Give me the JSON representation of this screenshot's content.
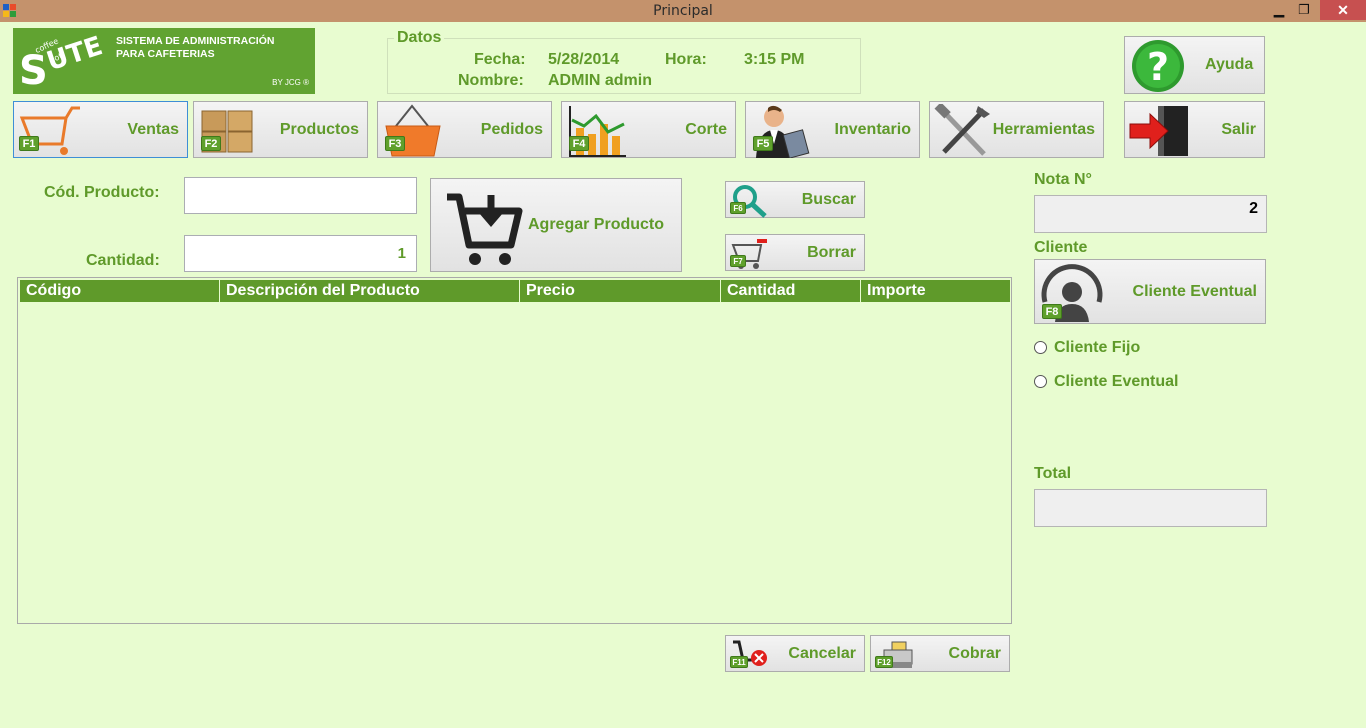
{
  "window": {
    "title": "Principal",
    "controls": {
      "minimize": "▁",
      "maximize": "❐",
      "close": "✕"
    }
  },
  "logo": {
    "brand": "SUITE",
    "tagline_1": "SISTEMA DE ADMINISTRACIÓN",
    "tagline_2": "PARA CAFETERIAS",
    "by": "BY JCG ®"
  },
  "datos": {
    "legend": "Datos",
    "fecha_label": "Fecha:",
    "fecha": "5/28/2014",
    "hora_label": "Hora:",
    "hora": "3:15 PM",
    "nombre_label": "Nombre:",
    "nombre": "ADMIN admin"
  },
  "ayuda": {
    "label": "Ayuda",
    "icon": "question-icon"
  },
  "toolbar": [
    {
      "label": "Ventas",
      "key": "F1",
      "icon": "cart-icon"
    },
    {
      "label": "Productos",
      "key": "F2",
      "icon": "boxes-icon"
    },
    {
      "label": "Pedidos",
      "key": "F3",
      "icon": "basket-icon"
    },
    {
      "label": "Corte",
      "key": "F4",
      "icon": "chart-icon"
    },
    {
      "label": "Inventario",
      "key": "F5",
      "icon": "person-calculator-icon"
    },
    {
      "label": "Herramientas",
      "key": "",
      "icon": "tools-icon"
    },
    {
      "label": "Salir",
      "key": "",
      "icon": "exit-door-icon"
    }
  ],
  "form": {
    "codigo_label": "Cód. Producto:",
    "codigo_value": "",
    "cantidad_label": "Cantidad:",
    "cantidad_value": "1"
  },
  "actions": {
    "agregar": "Agregar Producto",
    "buscar": "Buscar",
    "buscar_key": "F6",
    "borrar": "Borrar",
    "borrar_key": "F7",
    "cancelar": "Cancelar",
    "cancelar_key": "F11",
    "cobrar": "Cobrar",
    "cobrar_key": "F12"
  },
  "table": {
    "columns": [
      "Código",
      "Descripción del Producto",
      "Precio",
      "Cantidad",
      "Importe"
    ],
    "rows": []
  },
  "side": {
    "nota_label": "Nota N°",
    "nota_value": "2",
    "cliente_label": "Cliente",
    "cliente_button": "Cliente Eventual",
    "cliente_key": "F8",
    "radio_fijo": "Cliente Fijo",
    "radio_eventual": "Cliente Eventual",
    "total_label": "Total",
    "total_value": ""
  },
  "colors": {
    "accent": "#5f9a2a",
    "background": "#e8fcd0",
    "titlebar": "#c4926c"
  }
}
